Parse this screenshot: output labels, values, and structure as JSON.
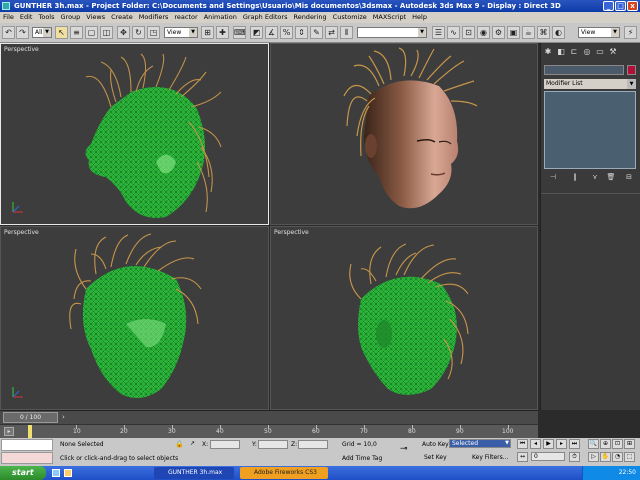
{
  "window": {
    "title": "GUNTHER 3h.max    - Project Folder: C:\\Documents and Settings\\Usuario\\Mis documentos\\3dsmax    - Autodesk 3ds Max 9    - Display : Direct 3D",
    "minimize": "_",
    "maximize": "□",
    "close": "x"
  },
  "menu": [
    "File",
    "Edit",
    "Tools",
    "Group",
    "Views",
    "Create",
    "Modifiers",
    "reactor",
    "Animation",
    "Graph Editors",
    "Rendering",
    "Customize",
    "MAXScript",
    "Help"
  ],
  "toolbar": {
    "selection_filter": "All",
    "reference_coord": "View",
    "named_selection": "",
    "panel_dropdown": "View"
  },
  "viewports": [
    {
      "label": "Perspective",
      "mode": "wireframe-shaded",
      "active": true
    },
    {
      "label": "",
      "mode": "rendered"
    },
    {
      "label": "Perspective",
      "mode": "wireframe-shaded",
      "active": false
    },
    {
      "label": "Perspective",
      "mode": "wireframe-shaded",
      "active": false
    }
  ],
  "command_panel": {
    "object_name": "",
    "modifier_list": "Modifier List",
    "accent_color": "#b0103a"
  },
  "timeline": {
    "frame_display": "0 / 100",
    "ticks": [
      "10",
      "20",
      "30",
      "40",
      "50",
      "60",
      "70",
      "80",
      "90",
      "100"
    ]
  },
  "status": {
    "selection": "None Selected",
    "prompt": "Click or click-and-drag to select objects",
    "x_label": "X:",
    "y_label": "Y:",
    "z_label": "Z:",
    "x_value": "",
    "y_value": "",
    "z_value": "",
    "grid": "Grid = 10,0",
    "add_time_tag": "Add Time Tag",
    "auto_key": "Auto Key",
    "auto_key_mode": "Selected",
    "set_key": "Set Key",
    "key_filters": "Key Filters...",
    "current_frame": "0"
  },
  "taskbar": {
    "start": "start",
    "tasks": [
      "GUNTHER 3h.max",
      "Adobe Fireworks CS3"
    ],
    "clock": "22:50"
  },
  "colors": {
    "wire_green": "#2fbf3f",
    "hair": "#c8964a",
    "viewport_bg": "#3d3d3d",
    "xp_blue": "#2458d0"
  }
}
